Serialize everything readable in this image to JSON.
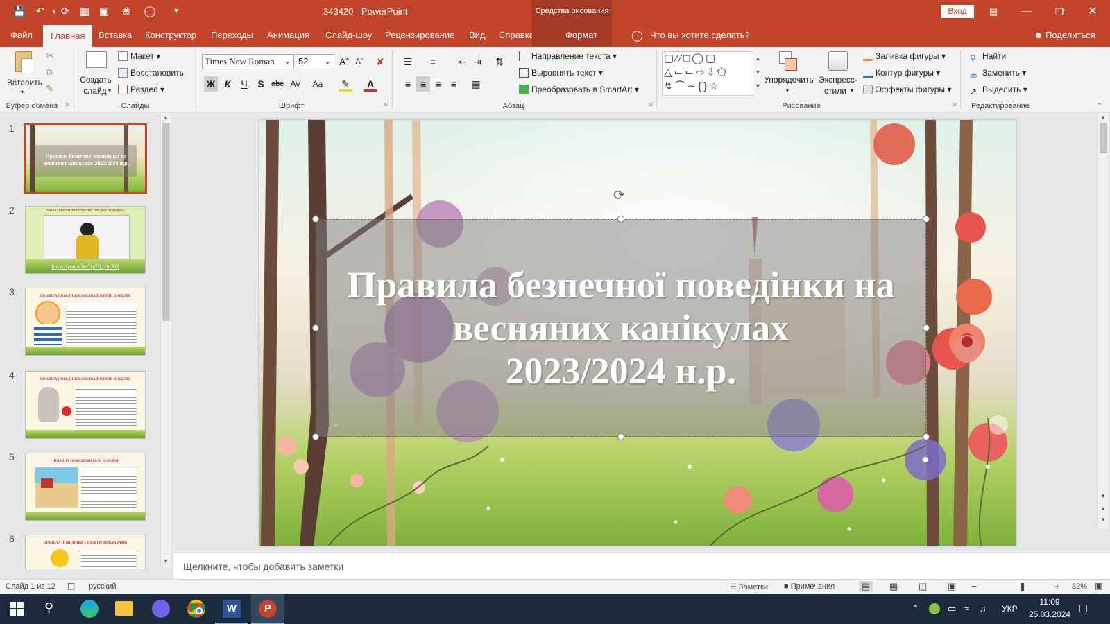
{
  "window": {
    "title": "343420  -  PowerPoint",
    "context_label": "Средства рисования",
    "signin_label": "Вход"
  },
  "tabs": [
    {
      "label": "Файл"
    },
    {
      "label": "Главная"
    },
    {
      "label": "Вставка"
    },
    {
      "label": "Конструктор"
    },
    {
      "label": "Переходы"
    },
    {
      "label": "Анимация"
    },
    {
      "label": "Слайд-шоу"
    },
    {
      "label": "Рецензирование"
    },
    {
      "label": "Вид"
    },
    {
      "label": "Справка"
    },
    {
      "label": "Формат"
    }
  ],
  "tell_me": "Что вы хотите сделать?",
  "share_label": "Поделиться",
  "ribbon": {
    "clipboard": {
      "paste": "Вставить",
      "group": "Буфер обмена"
    },
    "slides": {
      "new_slide_1": "Создать",
      "new_slide_2": "слайд",
      "layout": "Макет",
      "reset": "Восстановить",
      "section": "Раздел",
      "group": "Слайды"
    },
    "font": {
      "name": "Times New Roman",
      "size": "52",
      "group": "Шрифт"
    },
    "paragraph": {
      "direction": "Направление текста",
      "align": "Выровнять текст",
      "smartart": "Преобразовать в SmartArt",
      "group": "Абзац"
    },
    "drawing": {
      "arrange": "Упорядочить",
      "quick_1": "Экспресс-",
      "quick_2": "стили",
      "fill": "Заливка фигуры",
      "outline": "Контур фигуры",
      "effects": "Эффекты фигуры",
      "group": "Рисование"
    },
    "editing": {
      "find": "Найти",
      "replace": "Заменить",
      "select": "Выделить",
      "group": "Редактирование"
    }
  },
  "thumbnails": [
    {
      "num": "1",
      "title": "Правила безпечної поведінки на весняних канікулах 2023/2024 н.р."
    },
    {
      "num": "2",
      "title": "УВАГА! ВИБУХОНЕБЕЗПЕЧНІ ПРЕДМЕТИ (ВІДЕО)",
      "link": "https://youtu.be/7rg70_yfnXQ"
    },
    {
      "num": "3",
      "title": "ПРАВИЛА ПОВЕДІНКИ З НЕЗНАЙОМИМИ ЛЮДЬМИ"
    },
    {
      "num": "4",
      "title": "ПРАВИЛА ПОВЕДІНКИ З НЕЗНАЙОМИМИ ЛЮДЬМИ"
    },
    {
      "num": "5",
      "title": "ПРАВИЛА ПОВЕДІНКИ БІЛЯ ВОДОЙМ"
    },
    {
      "num": "6",
      "title": "ПРАВИЛА ПОВЕДІНКИ З ЕЛЕКТРОПРИЛАДАМИ"
    }
  ],
  "slide": {
    "line1": "Правила безпечної поведінки на",
    "line2": "весняних канікулах",
    "line3": "2023/2024 н.р."
  },
  "notes_placeholder": "Щелкните, чтобы добавить заметки",
  "status": {
    "slide_counter": "Слайд 1 из 12",
    "language": "русский",
    "notes": "Заметки",
    "comments": "Примечания",
    "zoom": "82%",
    "zoom_fraction": 0.6
  },
  "taskbar": {
    "keyboard": "УКР",
    "time": "11:09",
    "date": "25.03.2024"
  },
  "colors": {
    "accent": "#c1442b",
    "taskbar": "#1b2b3c"
  }
}
